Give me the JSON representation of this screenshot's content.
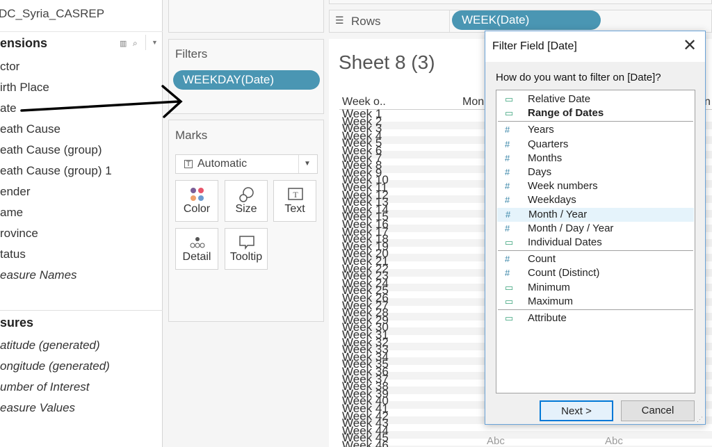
{
  "sidebar": {
    "datasource": "DC_Syria_CASREP",
    "dimensions_header": "ensions",
    "dimensions": [
      "ctor",
      "irth Place",
      "ate",
      "eath Cause",
      "eath Cause (group)",
      "eath Cause (group) 1",
      "ender",
      "ame",
      "rovince",
      "tatus"
    ],
    "dimension_italic": "easure Names",
    "measures_header": "sures",
    "measures": [
      "atitude (generated)",
      "ongitude (generated)",
      "umber of Interest",
      "easure Values"
    ]
  },
  "filters": {
    "title": "Filters",
    "pill": "WEEKDAY(Date)"
  },
  "marks": {
    "title": "Marks",
    "type": "Automatic",
    "cards": [
      "Color",
      "Size",
      "Text",
      "Detail",
      "Tooltip"
    ]
  },
  "rows": {
    "label": "Rows",
    "pill": "WEEK(Date)"
  },
  "sheet": {
    "title": "Sheet 8 (3)",
    "col_header": "Week o..",
    "col2": "Mon",
    "col3": "n",
    "abc": "Abc",
    "weeks": [
      "Week 1",
      "Week 2",
      "Week 3",
      "Week 4",
      "Week 5",
      "Week 6",
      "Week 7",
      "Week 8",
      "Week 9",
      "Week 10",
      "Week 11",
      "Week 12",
      "Week 13",
      "Week 14",
      "Week 15",
      "Week 16",
      "Week 17",
      "Week 18",
      "Week 19",
      "Week 20",
      "Week 21",
      "Week 22",
      "Week 23",
      "Week 24",
      "Week 25",
      "Week 26",
      "Week 27",
      "Week 28",
      "Week 29",
      "Week 30",
      "Week 31",
      "Week 32",
      "Week 33",
      "Week 34",
      "Week 35",
      "Week 36",
      "Week 37",
      "Week 38",
      "Week 39",
      "Week 40",
      "Week 41",
      "Week 42",
      "Week 43",
      "Week 44",
      "Week 45",
      "Week 46"
    ]
  },
  "dialog": {
    "title": "Filter Field [Date]",
    "question": "How do you want to filter on [Date]?",
    "groups": [
      [
        {
          "icon": "calendar-icon",
          "label": "Relative Date"
        },
        {
          "icon": "calendar-icon",
          "label": "Range of Dates",
          "bold": true
        }
      ],
      [
        {
          "icon": "hash-icon",
          "label": "Years"
        },
        {
          "icon": "hash-icon",
          "label": "Quarters"
        },
        {
          "icon": "hash-icon",
          "label": "Months"
        },
        {
          "icon": "hash-icon",
          "label": "Days"
        },
        {
          "icon": "hash-icon",
          "label": "Week numbers"
        },
        {
          "icon": "hash-icon",
          "label": "Weekdays"
        },
        {
          "icon": "hash-icon",
          "label": "Month / Year",
          "highlighted": true
        },
        {
          "icon": "hash-icon",
          "label": "Month / Day / Year"
        },
        {
          "icon": "calendar-icon",
          "label": "Individual Dates"
        }
      ],
      [
        {
          "icon": "hash-icon",
          "label": "Count"
        },
        {
          "icon": "hash-icon",
          "label": "Count (Distinct)"
        },
        {
          "icon": "calendar-icon",
          "label": "Minimum"
        },
        {
          "icon": "calendar-icon",
          "label": "Maximum"
        }
      ],
      [
        {
          "icon": "calendar-icon",
          "label": "Attribute"
        }
      ]
    ],
    "next": "Next >",
    "cancel": "Cancel"
  },
  "colors": {
    "pill": "#4a96b3",
    "accent": "#0078d7",
    "icon": "#3aa37a"
  }
}
